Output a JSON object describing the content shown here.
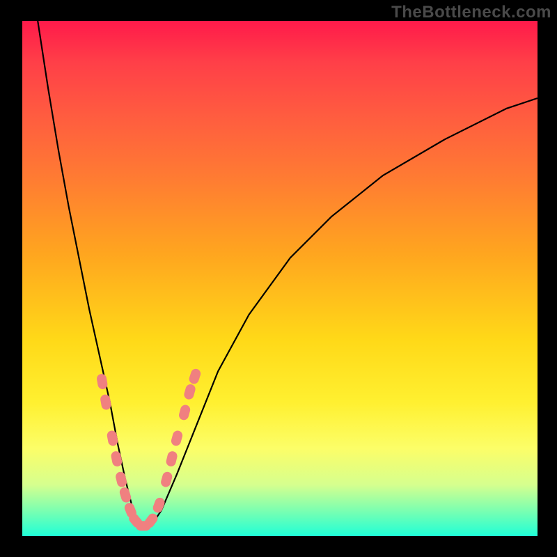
{
  "watermark": "TheBottleneck.com",
  "chart_data": {
    "type": "line",
    "title": "",
    "xlabel": "",
    "ylabel": "",
    "xlim": [
      0,
      100
    ],
    "ylim": [
      0,
      100
    ],
    "series": [
      {
        "name": "bottleneck-curve",
        "x": [
          3,
          5,
          7,
          9,
          11,
          13,
          15,
          17,
          18.5,
          20,
          21.5,
          23,
          25,
          27,
          30,
          34,
          38,
          44,
          52,
          60,
          70,
          82,
          94,
          100
        ],
        "y": [
          100,
          87,
          75,
          64,
          54,
          44,
          35,
          26,
          18,
          11,
          5,
          2,
          2,
          5,
          12,
          22,
          32,
          43,
          54,
          62,
          70,
          77,
          83,
          85
        ]
      }
    ],
    "markers": {
      "name": "highlight-points",
      "color": "#f08080",
      "points": [
        {
          "x": 15.5,
          "y": 30
        },
        {
          "x": 16.2,
          "y": 26
        },
        {
          "x": 17.5,
          "y": 19
        },
        {
          "x": 18.3,
          "y": 15
        },
        {
          "x": 19.2,
          "y": 11
        },
        {
          "x": 20.0,
          "y": 8
        },
        {
          "x": 21.0,
          "y": 5
        },
        {
          "x": 22.0,
          "y": 3
        },
        {
          "x": 23.5,
          "y": 2
        },
        {
          "x": 25.0,
          "y": 3
        },
        {
          "x": 26.5,
          "y": 6
        },
        {
          "x": 28.0,
          "y": 11
        },
        {
          "x": 29.0,
          "y": 15
        },
        {
          "x": 30.0,
          "y": 19
        },
        {
          "x": 31.5,
          "y": 24
        },
        {
          "x": 32.5,
          "y": 28
        },
        {
          "x": 33.5,
          "y": 31
        }
      ]
    }
  }
}
